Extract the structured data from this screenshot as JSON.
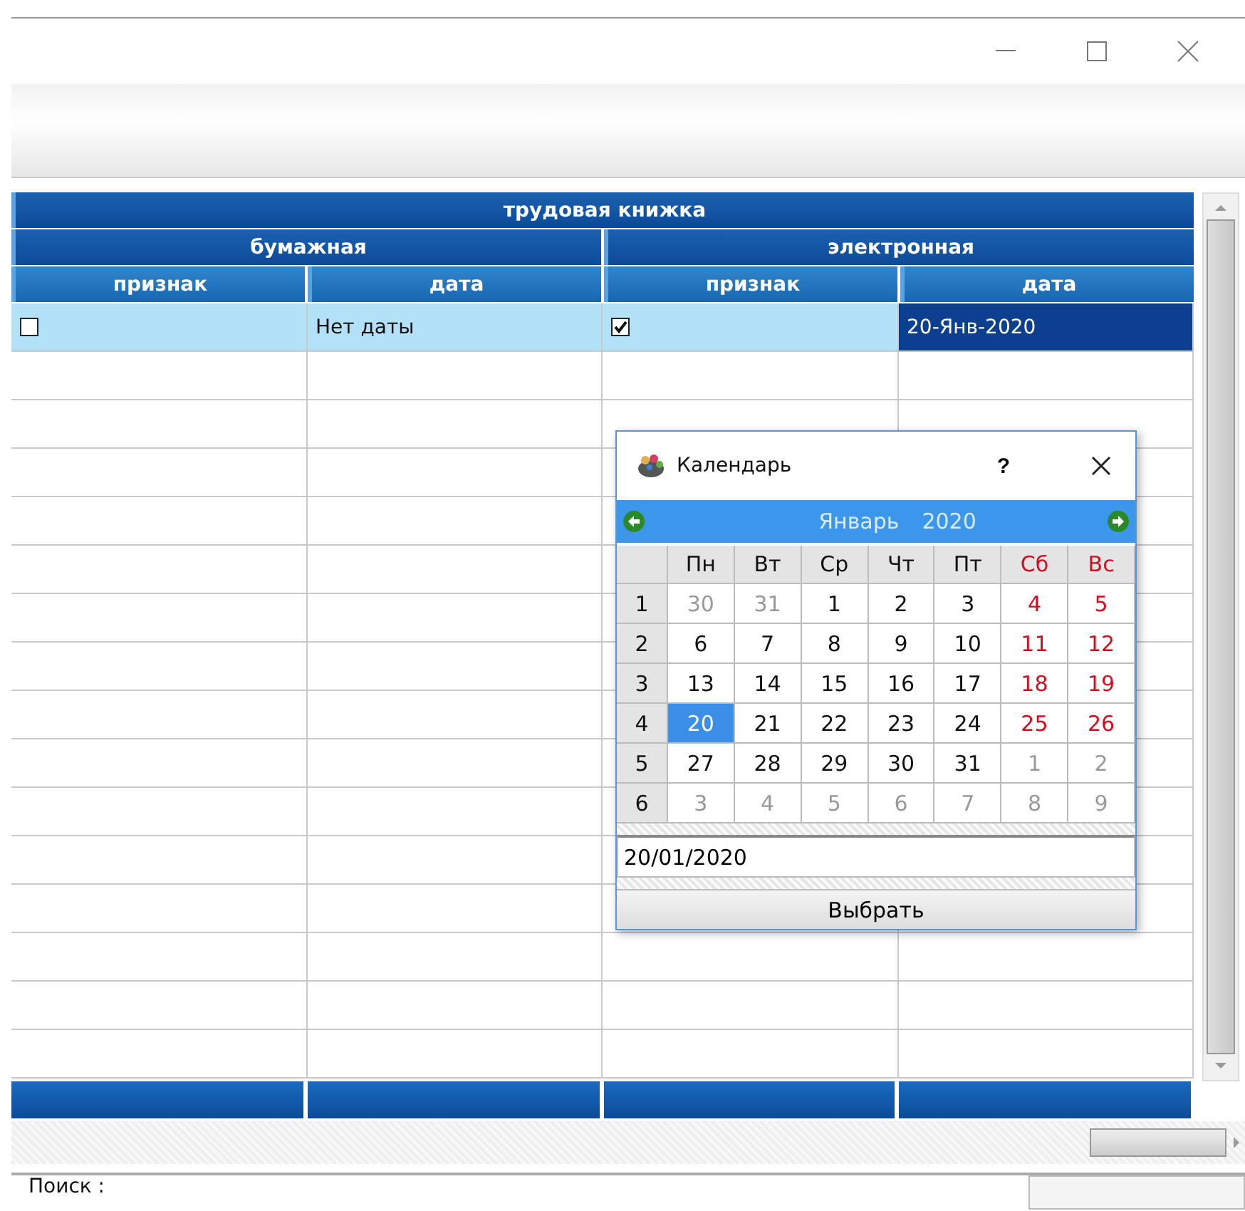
{
  "table": {
    "title": "трудовая книжка",
    "groups": [
      "бумажная",
      "электронная"
    ],
    "columns": [
      "признак",
      "дата",
      "признак",
      "дата"
    ],
    "rows": [
      {
        "selected": true,
        "cells": [
          {
            "kind": "checkbox",
            "checked": false,
            "selected": false
          },
          {
            "kind": "text",
            "text": "Нет даты",
            "selected": false
          },
          {
            "kind": "checkbox",
            "checked": true,
            "selected": false
          },
          {
            "kind": "text",
            "text": "20-Янв-2020",
            "selected": true
          }
        ]
      }
    ]
  },
  "calendar": {
    "title": "Календарь",
    "help": "?",
    "month": "Январь",
    "year": "2020",
    "weekdays": [
      {
        "text": "Пн",
        "weekend": false
      },
      {
        "text": "Вт",
        "weekend": false
      },
      {
        "text": "Ср",
        "weekend": false
      },
      {
        "text": "Чт",
        "weekend": false
      },
      {
        "text": "Пт",
        "weekend": false
      },
      {
        "text": "Сб",
        "weekend": true
      },
      {
        "text": "Вс",
        "weekend": true
      }
    ],
    "weeks": [
      {
        "number": "1",
        "days": [
          {
            "text": "30",
            "kind": "outside",
            "selected": false
          },
          {
            "text": "31",
            "kind": "outside",
            "selected": false
          },
          {
            "text": "1",
            "kind": "workday",
            "selected": false
          },
          {
            "text": "2",
            "kind": "workday",
            "selected": false
          },
          {
            "text": "3",
            "kind": "workday",
            "selected": false
          },
          {
            "text": "4",
            "kind": "weekend",
            "selected": false
          },
          {
            "text": "5",
            "kind": "weekend",
            "selected": false
          }
        ]
      },
      {
        "number": "2",
        "days": [
          {
            "text": "6",
            "kind": "workday",
            "selected": false
          },
          {
            "text": "7",
            "kind": "workday",
            "selected": false
          },
          {
            "text": "8",
            "kind": "workday",
            "selected": false
          },
          {
            "text": "9",
            "kind": "workday",
            "selected": false
          },
          {
            "text": "10",
            "kind": "workday",
            "selected": false
          },
          {
            "text": "11",
            "kind": "weekend",
            "selected": false
          },
          {
            "text": "12",
            "kind": "weekend",
            "selected": false
          }
        ]
      },
      {
        "number": "3",
        "days": [
          {
            "text": "13",
            "kind": "workday",
            "selected": false
          },
          {
            "text": "14",
            "kind": "workday",
            "selected": false
          },
          {
            "text": "15",
            "kind": "workday",
            "selected": false
          },
          {
            "text": "16",
            "kind": "workday",
            "selected": false
          },
          {
            "text": "17",
            "kind": "workday",
            "selected": false
          },
          {
            "text": "18",
            "kind": "weekend",
            "selected": false
          },
          {
            "text": "19",
            "kind": "weekend",
            "selected": false
          }
        ]
      },
      {
        "number": "4",
        "days": [
          {
            "text": "20",
            "kind": "workday",
            "selected": true
          },
          {
            "text": "21",
            "kind": "workday",
            "selected": false
          },
          {
            "text": "22",
            "kind": "workday",
            "selected": false
          },
          {
            "text": "23",
            "kind": "workday",
            "selected": false
          },
          {
            "text": "24",
            "kind": "workday",
            "selected": false
          },
          {
            "text": "25",
            "kind": "weekend",
            "selected": false
          },
          {
            "text": "26",
            "kind": "weekend",
            "selected": false
          }
        ]
      },
      {
        "number": "5",
        "days": [
          {
            "text": "27",
            "kind": "workday",
            "selected": false
          },
          {
            "text": "28",
            "kind": "workday",
            "selected": false
          },
          {
            "text": "29",
            "kind": "workday",
            "selected": false
          },
          {
            "text": "30",
            "kind": "workday",
            "selected": false
          },
          {
            "text": "31",
            "kind": "workday",
            "selected": false
          },
          {
            "text": "1",
            "kind": "outside",
            "selected": false
          },
          {
            "text": "2",
            "kind": "outside",
            "selected": false
          }
        ]
      },
      {
        "number": "6",
        "days": [
          {
            "text": "3",
            "kind": "outside",
            "selected": false
          },
          {
            "text": "4",
            "kind": "outside",
            "selected": false
          },
          {
            "text": "5",
            "kind": "outside",
            "selected": false
          },
          {
            "text": "6",
            "kind": "outside",
            "selected": false
          },
          {
            "text": "7",
            "kind": "outside",
            "selected": false
          },
          {
            "text": "8",
            "kind": "outside",
            "selected": false
          },
          {
            "text": "9",
            "kind": "outside",
            "selected": false
          }
        ]
      }
    ],
    "date_value": "20/01/2020",
    "button": "Выбрать"
  },
  "search": {
    "label": "Поиск :"
  }
}
